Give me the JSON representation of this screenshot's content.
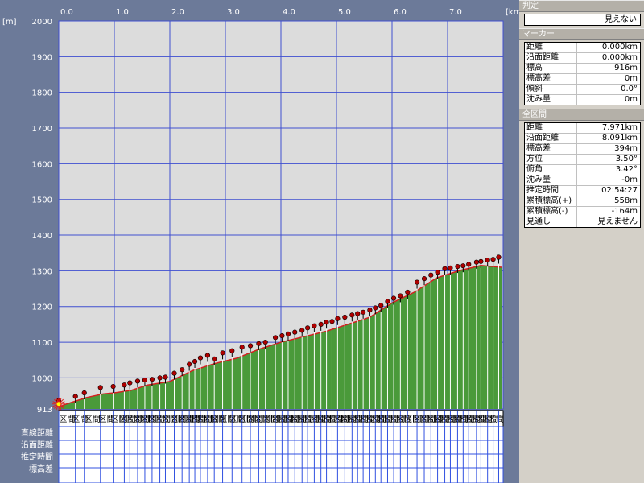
{
  "chart_data": {
    "type": "area",
    "x_unit": "[km]",
    "y_unit": "[m]",
    "xlim": [
      0,
      8.0
    ],
    "ylim": [
      913,
      2000
    ],
    "x_ticks": [
      "0.0",
      "1.0",
      "2.0",
      "3.0",
      "4.0",
      "5.0",
      "6.0",
      "7.0"
    ],
    "y_ticks": [
      "2000",
      "1900",
      "1800",
      "1700",
      "1600",
      "1500",
      "1400",
      "1300",
      "1200",
      "1100",
      "1000",
      "913"
    ],
    "profile_x": [
      0,
      0.1,
      0.3,
      0.5,
      0.8,
      1.0,
      1.3,
      1.6,
      2.0,
      2.4,
      2.8,
      3.2,
      3.6,
      4.0,
      4.4,
      4.8,
      5.2,
      5.6,
      6.0,
      6.4,
      6.8,
      7.2,
      7.6,
      7.971
    ],
    "profile_y": [
      916,
      925,
      935,
      945,
      955,
      958,
      965,
      980,
      990,
      1020,
      1040,
      1055,
      1080,
      1100,
      1115,
      1130,
      1150,
      1170,
      1210,
      1240,
      1280,
      1300,
      1315,
      1310
    ],
    "markers_x": [
      0.0,
      0.3,
      0.46,
      0.75,
      0.98,
      1.18,
      1.28,
      1.42,
      1.55,
      1.68,
      1.82,
      1.92,
      2.08,
      2.22,
      2.35,
      2.45,
      2.55,
      2.68,
      2.8,
      2.95,
      3.12,
      3.3,
      3.45,
      3.6,
      3.72,
      3.9,
      4.02,
      4.13,
      4.25,
      4.38,
      4.48,
      4.6,
      4.72,
      4.82,
      4.92,
      5.02,
      5.15,
      5.28,
      5.38,
      5.48,
      5.6,
      5.7,
      5.8,
      5.92,
      6.03,
      6.15,
      6.28,
      6.45,
      6.58,
      6.7,
      6.82,
      6.95,
      7.05,
      7.18,
      7.28,
      7.38,
      7.52,
      7.6,
      7.72,
      7.82,
      7.92
    ],
    "markers_y": [
      918,
      930,
      940,
      955,
      958,
      962,
      968,
      973,
      976,
      978,
      982,
      984,
      995,
      1005,
      1020,
      1028,
      1038,
      1045,
      1035,
      1052,
      1058,
      1068,
      1072,
      1078,
      1082,
      1095,
      1100,
      1105,
      1110,
      1115,
      1122,
      1128,
      1132,
      1138,
      1140,
      1148,
      1152,
      1158,
      1162,
      1166,
      1172,
      1178,
      1185,
      1196,
      1205,
      1212,
      1222,
      1250,
      1260,
      1270,
      1278,
      1288,
      1290,
      1294,
      1296,
      1300,
      1306,
      1308,
      1312,
      1314,
      1320
    ]
  },
  "table": {
    "row_labels": [
      "直線距離",
      "沿面距離",
      "推定時間",
      "標高差"
    ],
    "header_cell": "区間"
  },
  "side": {
    "judge": {
      "title": "判定",
      "value": "見えない"
    },
    "marker": {
      "title": "マーカー",
      "rows": [
        {
          "k": "距離",
          "v": "0.000km"
        },
        {
          "k": "沿面距離",
          "v": "0.000km"
        },
        {
          "k": "標高",
          "v": "916m"
        },
        {
          "k": "標高差",
          "v": "0m"
        },
        {
          "k": "傾斜",
          "v": "0.0°"
        },
        {
          "k": "沈み量",
          "v": "0m"
        }
      ]
    },
    "all": {
      "title": "全区間",
      "rows": [
        {
          "k": "距離",
          "v": "7.971km"
        },
        {
          "k": "沿面距離",
          "v": "8.091km"
        },
        {
          "k": "標高差",
          "v": "394m"
        },
        {
          "k": "方位",
          "v": "3.50°"
        },
        {
          "k": "俯角",
          "v": "3.42°"
        },
        {
          "k": "沈み量",
          "v": "-0m"
        },
        {
          "k": "推定時間",
          "v": "02:54:27"
        },
        {
          "k": "累積標高(+)",
          "v": "558m"
        },
        {
          "k": "累積標高(-)",
          "v": "-164m"
        },
        {
          "k": "見通し",
          "v": "見えません"
        }
      ]
    }
  },
  "colors": {
    "plot_bg": "#dcdcdc",
    "grid": "#3f4fd0",
    "fill": "#4a9a3a",
    "profile_line": "#d42020",
    "marker_pin": "#b00000",
    "table_bg": "#ffffff",
    "table_grid": "#3050e0"
  }
}
